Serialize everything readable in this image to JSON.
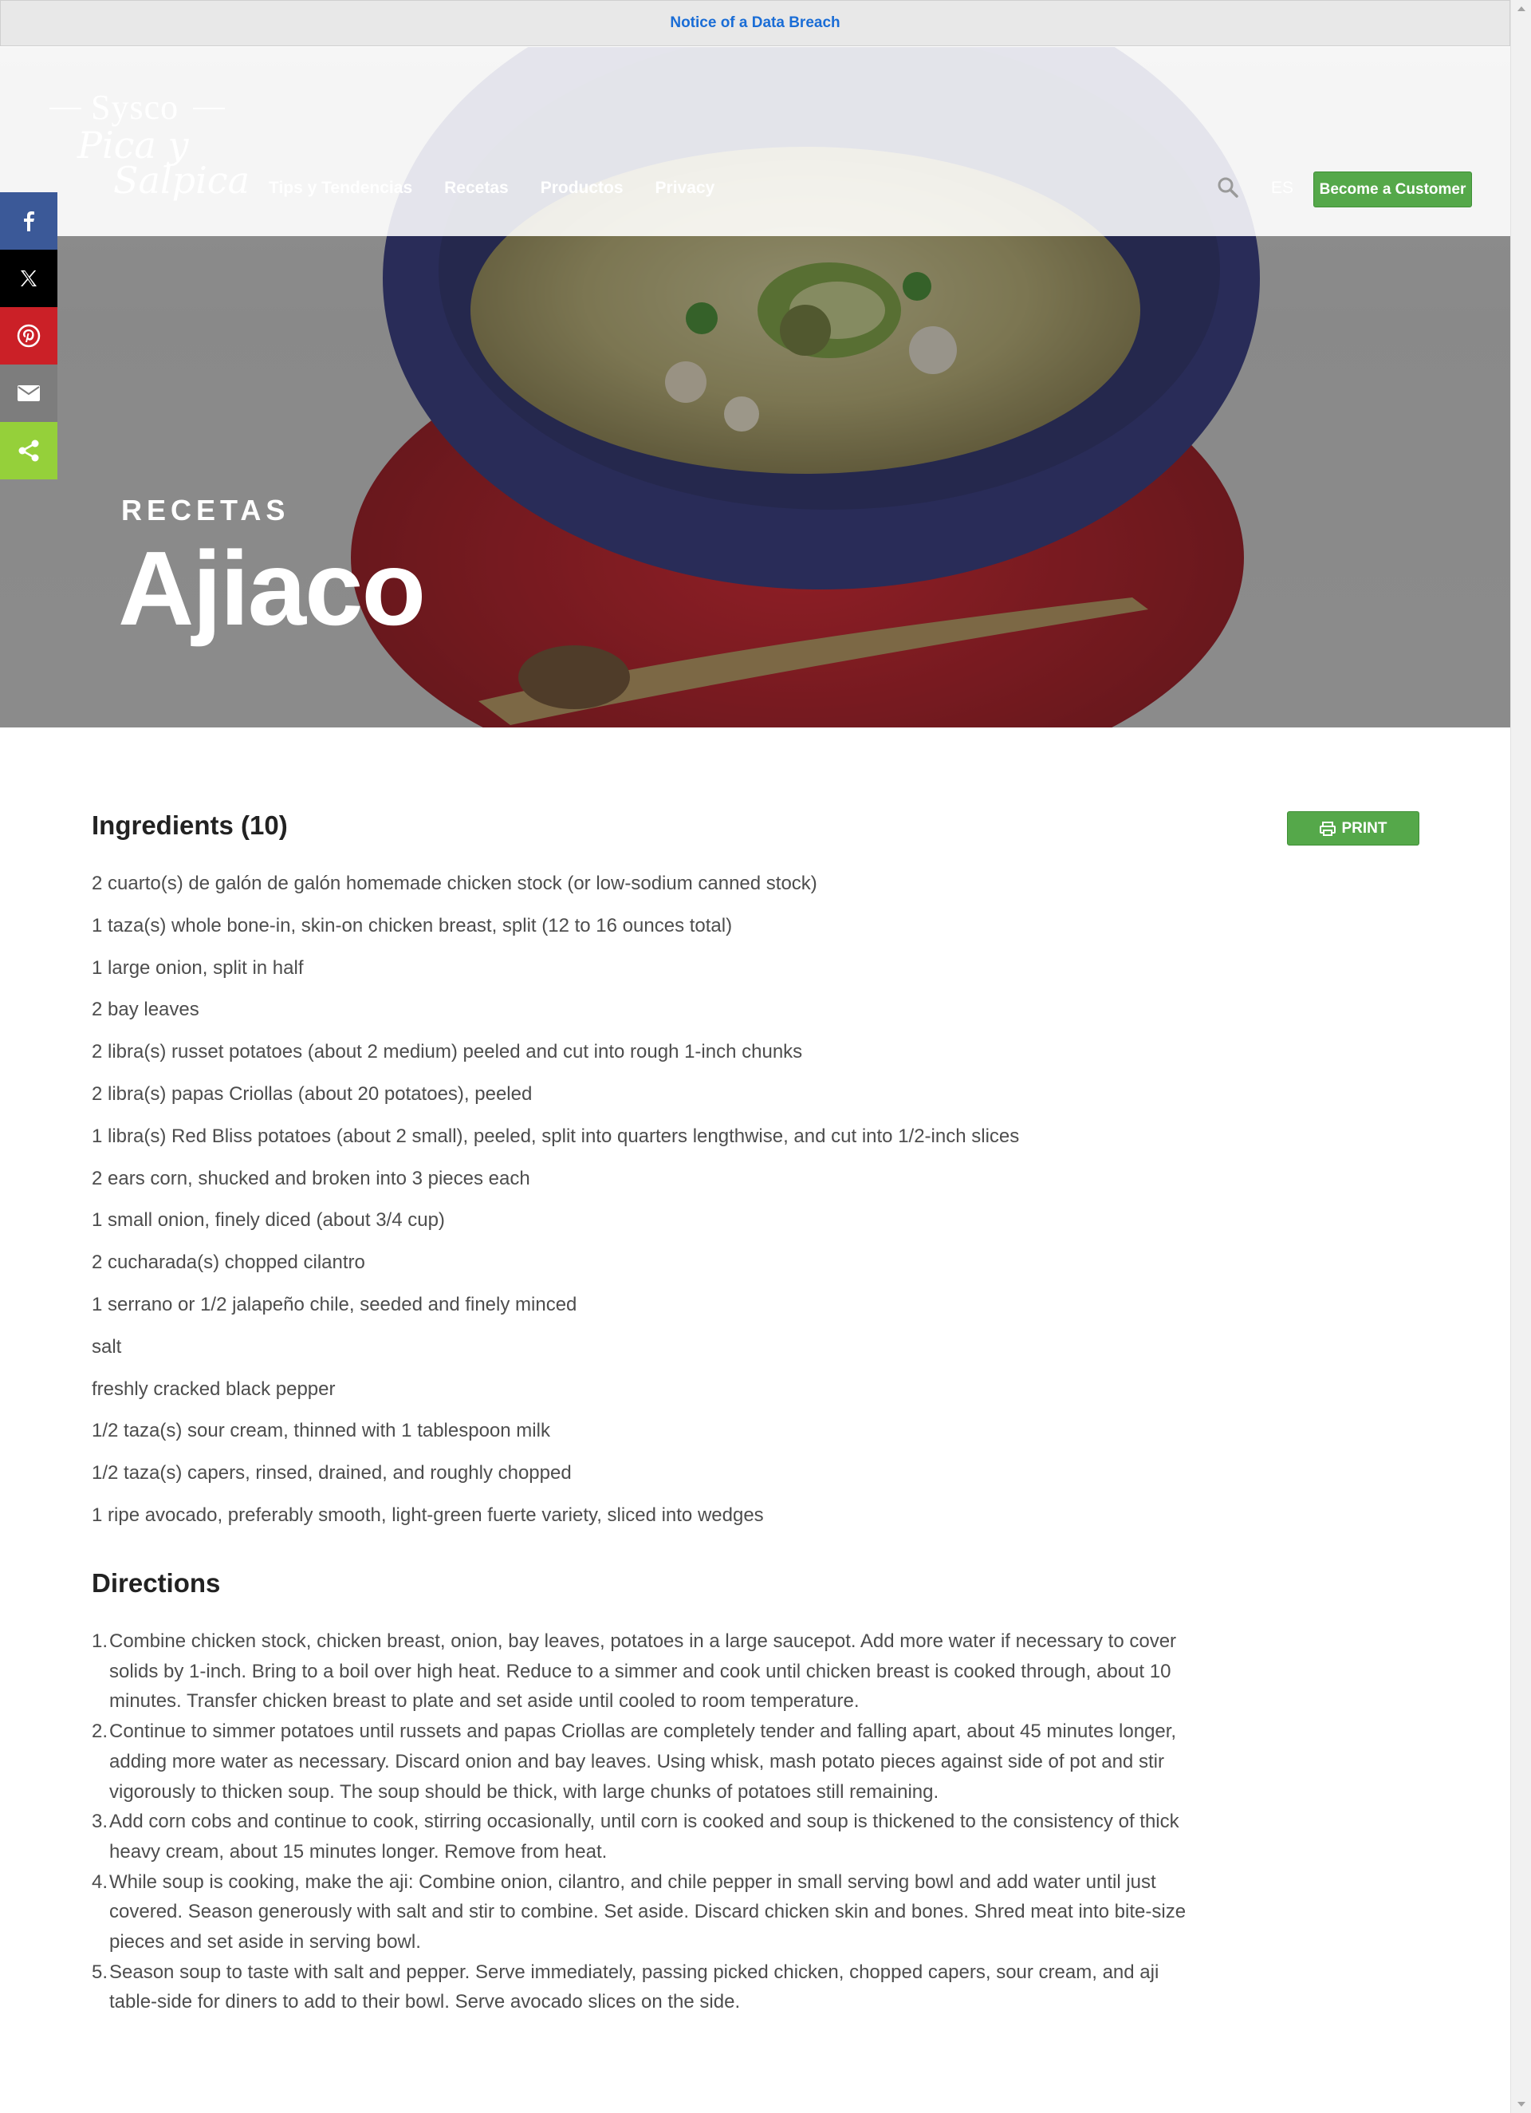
{
  "notice": {
    "link_text": "Notice of a Data Breach"
  },
  "logo": {
    "brand": "Sysco",
    "sub1": "Pica y",
    "sub2": "Salpica"
  },
  "nav": {
    "items": [
      "Tips y Tendencias",
      "Recetas",
      "Productos",
      "Privacy"
    ],
    "lang": "ES",
    "cta": "Become a Customer"
  },
  "hero": {
    "label": "RECETAS",
    "title": "Ajiaco"
  },
  "social": [
    "facebook",
    "x",
    "pinterest",
    "email",
    "share"
  ],
  "ingredients": {
    "title": "Ingredients (10)",
    "print_label": "PRINT",
    "items": [
      "2 cuarto(s) de galón de galón homemade chicken stock (or low-sodium canned stock)",
      "1 taza(s) whole bone-in, skin-on chicken breast, split (12 to 16 ounces total)",
      "1 large onion, split in half",
      "2 bay leaves",
      "2 libra(s) russet potatoes (about 2 medium) peeled and cut into rough 1-inch chunks",
      "2 libra(s) papas Criollas (about 20 potatoes), peeled",
      "1 libra(s) Red Bliss potatoes (about 2 small), peeled, split into quarters lengthwise, and cut into 1/2-inch slices",
      "2 ears corn, shucked and broken into 3 pieces each",
      "1 small onion, finely diced (about 3/4 cup)",
      "2 cucharada(s) chopped cilantro",
      "1 serrano or 1/2 jalapeño chile, seeded and finely minced",
      "salt",
      "freshly cracked black pepper",
      "1/2 taza(s) sour cream, thinned with 1 tablespoon milk",
      "1/2 taza(s) capers, rinsed, drained, and roughly chopped",
      "1 ripe avocado, preferably smooth, light-green fuerte variety, sliced into wedges"
    ]
  },
  "directions": {
    "title": "Directions",
    "steps": [
      {
        "num": "1.",
        "text": "Combine chicken stock, chicken breast, onion, bay leaves, potatoes in a large saucepot. Add more water if necessary to cover solids by 1-inch. Bring to a boil over high heat. Reduce to a simmer and cook until chicken breast is cooked through, about 10 minutes. Transfer chicken breast to plate and set aside until cooled to room temperature."
      },
      {
        "num": "2.",
        "text": "Continue to simmer potatoes until russets and papas Criollas are completely tender and falling apart, about 45 minutes longer, adding more water as necessary. Discard onion and bay leaves. Using whisk, mash potato pieces against side of pot and stir vigorously to thicken soup. The soup should be thick, with large chunks of potatoes still remaining."
      },
      {
        "num": "3.",
        "text": "Add corn cobs and continue to cook, stirring occasionally, until corn is cooked and soup is thickened to the consistency of thick heavy cream, about 15 minutes longer. Remove from heat."
      },
      {
        "num": "4.",
        "text": "While soup is cooking, make the aji: Combine onion, cilantro, and chile pepper in small serving bowl and add water until just covered. Season generously with salt and stir to combine. Set aside. Discard chicken skin and bones. Shred meat into bite-size pieces and set aside in serving bowl."
      },
      {
        "num": "5.",
        "text": "Season soup to taste with salt and pepper. Serve immediately, passing picked chicken, chopped capers, sour cream, and aji table-side for diners to add to their bowl. Serve avocado slices on the side."
      }
    ]
  },
  "colors": {
    "accent_green": "#55a84a",
    "facebook": "#3b5998",
    "x": "#000000",
    "pinterest": "#cb2027",
    "email": "#7d7d7d",
    "share": "#95d03a",
    "notice_link": "#1a6dd6"
  }
}
